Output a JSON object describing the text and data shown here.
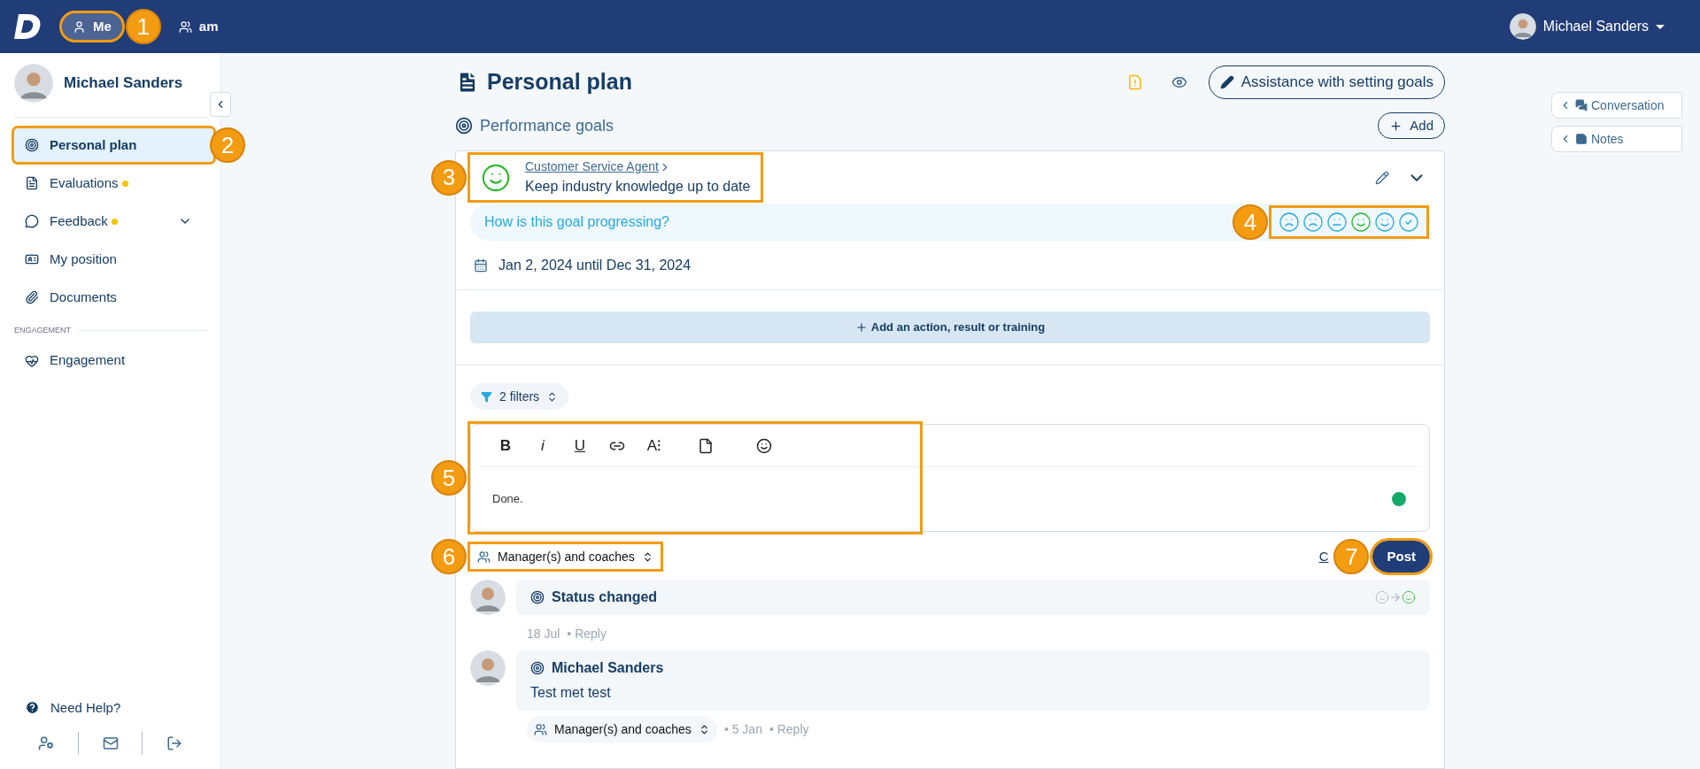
{
  "topbar": {
    "tabs": [
      {
        "label": "Me",
        "selected": true,
        "callout": "1"
      },
      {
        "label": "am",
        "selected": false
      }
    ],
    "user": "Michael Sanders"
  },
  "sidebar": {
    "user": "Michael Sanders",
    "items": [
      {
        "label": "Personal plan",
        "kind": "target",
        "selected": true,
        "dot": false,
        "expandable": false,
        "callout": "2"
      },
      {
        "label": "Evaluations",
        "kind": "file",
        "selected": false,
        "dot": true,
        "expandable": false
      },
      {
        "label": "Feedback",
        "kind": "chat",
        "selected": false,
        "dot": true,
        "expandable": true
      },
      {
        "label": "My position",
        "kind": "card",
        "selected": false,
        "dot": false,
        "expandable": false
      },
      {
        "label": "Documents",
        "kind": "clip",
        "selected": false,
        "dot": false,
        "expandable": false
      }
    ],
    "section": "ENGAGEMENT",
    "section_items": [
      {
        "label": "Engagement",
        "kind": "heart",
        "selected": false,
        "dot": false,
        "expandable": false
      }
    ],
    "help": "Need Help?"
  },
  "page": {
    "title": "Personal plan",
    "assist_button": "Assistance with setting goals",
    "section": "Performance goals",
    "add_button": "Add"
  },
  "goal": {
    "category": "Customer Service Agent",
    "title": "Keep industry knowledge up to date",
    "callout": "3",
    "question": "How is this goal progressing?",
    "mood_callout": "4",
    "moods": [
      {
        "kind": "very-sad",
        "selected": false
      },
      {
        "kind": "sad",
        "selected": false
      },
      {
        "kind": "neutral",
        "selected": false
      },
      {
        "kind": "happy",
        "selected": true
      },
      {
        "kind": "very-happy",
        "selected": false
      },
      {
        "kind": "done",
        "selected": false
      }
    ],
    "dates": "Jan 2, 2024 until Dec 31, 2024",
    "add_action": "Add an action, result or training",
    "filters": "2 filters",
    "editor": {
      "value": "Done.",
      "callout": "5",
      "tools": [
        {
          "kind": "bold",
          "label": "B"
        },
        {
          "kind": "italic",
          "label": "i"
        },
        {
          "kind": "underline",
          "label": "U"
        },
        {
          "kind": "link"
        },
        {
          "kind": "size",
          "label": "A⁝"
        },
        {
          "kind": "file"
        },
        {
          "kind": "emoji"
        }
      ]
    },
    "visibility": {
      "label": "Manager(s) and coaches",
      "callout": "6"
    },
    "cancel": "C",
    "post": {
      "label": "Post",
      "callout": "7"
    }
  },
  "comments": [
    {
      "kind": "status",
      "title": "Status changed",
      "date": "18 Jul",
      "reply": "• Reply"
    },
    {
      "kind": "message",
      "title": "Michael Sanders",
      "text": "Test met test",
      "visibility": "Manager(s) and coaches",
      "date": "• 5 Jan",
      "reply": "• Reply"
    }
  ],
  "right_panel": [
    {
      "label": "Conversation",
      "kind": "chat"
    },
    {
      "label": "Notes",
      "kind": "note"
    }
  ]
}
